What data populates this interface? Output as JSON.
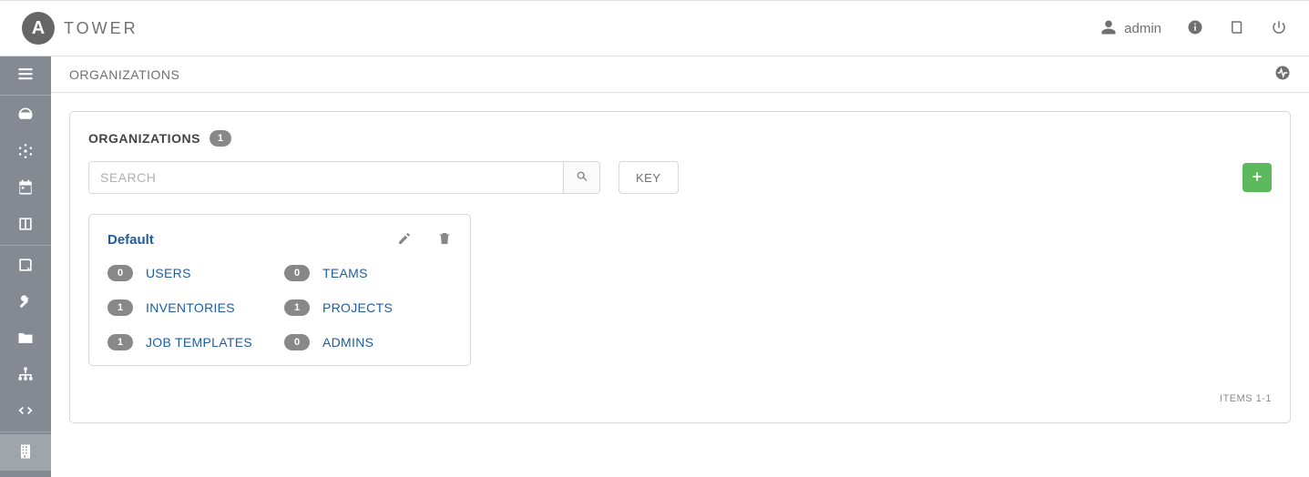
{
  "brand": {
    "logo_letter": "A",
    "name": "TOWER"
  },
  "topnav": {
    "username": "admin"
  },
  "breadcrumb": {
    "title": "ORGANIZATIONS"
  },
  "panel": {
    "title": "ORGANIZATIONS",
    "count": "1",
    "search_placeholder": "SEARCH",
    "key_label": "KEY",
    "pagination_label": "ITEMS 1-1"
  },
  "org_card": {
    "name": "Default",
    "links": {
      "users": {
        "count": "0",
        "label": "USERS"
      },
      "teams": {
        "count": "0",
        "label": "TEAMS"
      },
      "inventories": {
        "count": "1",
        "label": "INVENTORIES"
      },
      "projects": {
        "count": "1",
        "label": "PROJECTS"
      },
      "job_templates": {
        "count": "1",
        "label": "JOB TEMPLATES"
      },
      "admins": {
        "count": "0",
        "label": "ADMINS"
      }
    }
  },
  "colors": {
    "accent": "#1f5da0",
    "green": "#5cb85c",
    "sidebar": "#848992"
  }
}
